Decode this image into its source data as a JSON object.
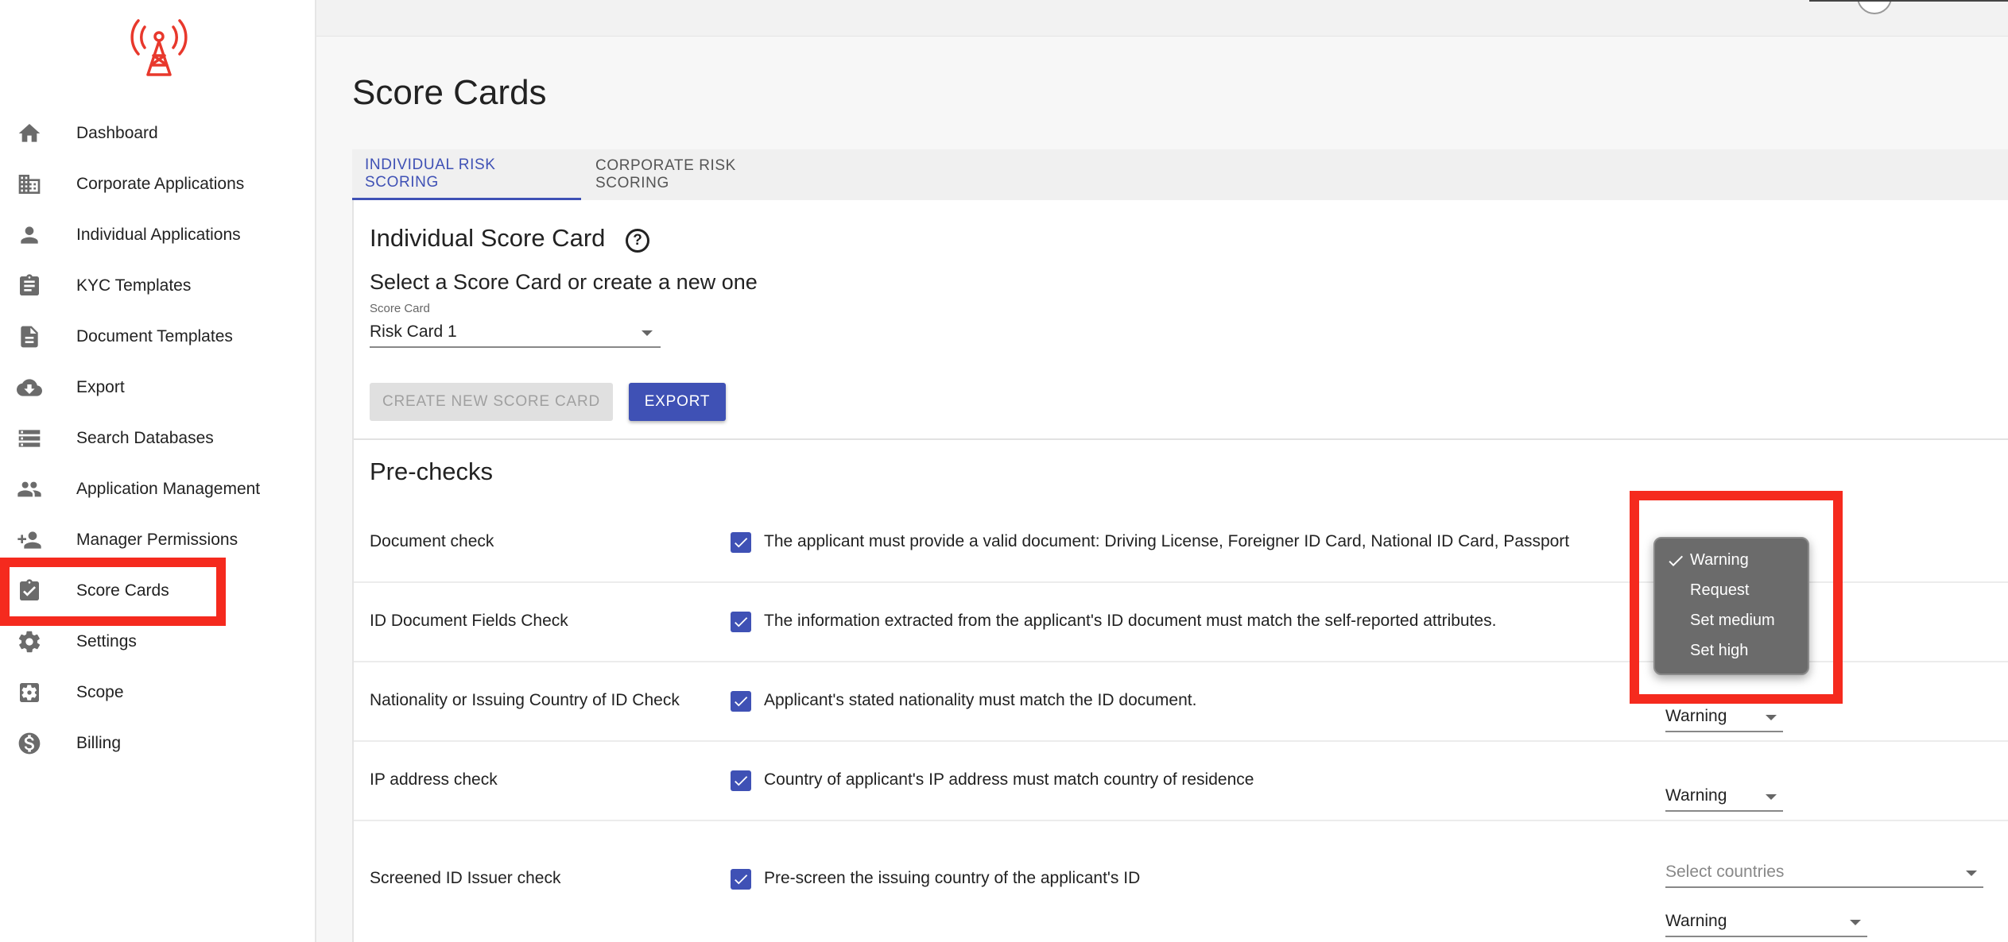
{
  "sidebar": {
    "items": [
      {
        "label": "Dashboard",
        "icon": "home-icon"
      },
      {
        "label": "Corporate Applications",
        "icon": "building-icon"
      },
      {
        "label": "Individual Applications",
        "icon": "person-icon"
      },
      {
        "label": "KYC Templates",
        "icon": "clipboard-icon"
      },
      {
        "label": "Document Templates",
        "icon": "document-icon"
      },
      {
        "label": "Export",
        "icon": "cloud-download-icon"
      },
      {
        "label": "Search Databases",
        "icon": "list-icon"
      },
      {
        "label": "Application Management",
        "icon": "people-icon"
      },
      {
        "label": "Manager Permissions",
        "icon": "person-add-icon"
      },
      {
        "label": "Score Cards",
        "icon": "clipboard-check-icon"
      },
      {
        "label": "Settings",
        "icon": "gear-icon"
      },
      {
        "label": "Scope",
        "icon": "settings-box-icon"
      },
      {
        "label": "Billing",
        "icon": "dollar-icon"
      }
    ],
    "selected": "Score Cards"
  },
  "page": {
    "title": "Score Cards"
  },
  "tabs": [
    {
      "label": "INDIVIDUAL RISK SCORING",
      "active": true
    },
    {
      "label": "CORPORATE RISK SCORING",
      "active": false
    }
  ],
  "card": {
    "title": "Individual Score Card",
    "subtitle": "Select a Score Card or create a new one",
    "select_label": "Score Card",
    "select_value": "Risk Card 1",
    "create_button": "CREATE NEW SCORE CARD",
    "export_button": "EXPORT"
  },
  "prechecks": {
    "title": "Pre-checks",
    "rows": [
      {
        "label": "Document check",
        "desc": "The applicant must provide a valid document: Driving License, Foreigner ID Card, National ID Card, Passport",
        "action": ""
      },
      {
        "label": "ID Document Fields Check",
        "desc": "The information extracted from the applicant's ID document must match the self-reported attributes.",
        "action": ""
      },
      {
        "label": "Nationality or Issuing Country of ID Check",
        "desc": "Applicant's stated nationality must match the ID document.",
        "action": "Warning"
      },
      {
        "label": "IP address check",
        "desc": "Country of applicant's IP address must match country of residence",
        "action": "Warning"
      },
      {
        "label": "Screened ID Issuer check",
        "desc": "Pre-screen the issuing country of the applicant's ID",
        "countries_placeholder": "Select countries",
        "action": "Warning"
      }
    ]
  },
  "dropdown": {
    "options": [
      "Warning",
      "Request",
      "Set medium",
      "Set high"
    ],
    "selected": "Warning"
  },
  "colors": {
    "accent": "#3f51b5",
    "highlight": "#f52a1e",
    "logo": "#e8382c"
  }
}
